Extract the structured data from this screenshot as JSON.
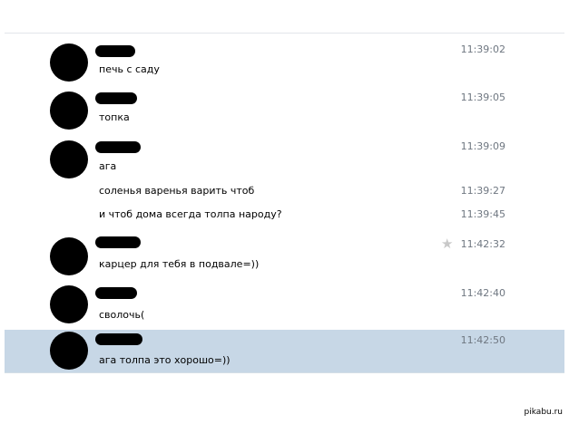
{
  "messages": [
    {
      "text": "печь с саду",
      "time": "11:39:02"
    },
    {
      "text": "топка",
      "time": "11:39:05"
    },
    {
      "text": "ага",
      "time": "11:39:09"
    },
    {
      "text": "соленья варенья варить чтоб",
      "time": "11:39:27"
    },
    {
      "text": "и чтоб дома всегда толпа народу?",
      "time": "11:39:45"
    },
    {
      "text": "карцер для тебя в подвале=))",
      "time": "11:42:32"
    },
    {
      "text": "сволочь(",
      "time": "11:42:40"
    },
    {
      "text": "ага толпа это хорошо=))",
      "time": "11:42:50"
    }
  ],
  "icons": {
    "favorite": "star-icon"
  },
  "colors": {
    "selected_row": "#c7d7e6",
    "timestamp": "#6f7781",
    "star": "#c8c8c8"
  },
  "watermark": "pikabu.ru"
}
